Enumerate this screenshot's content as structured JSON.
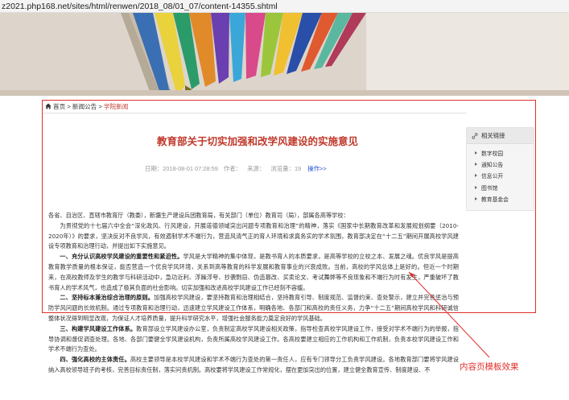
{
  "browser": {
    "url": "z2021.php168.net/sites/html/renwen/2018_08/01_07/content-14355.shtml"
  },
  "breadcrumb": {
    "home": "首页",
    "sep1": ">",
    "section": "新闻公告",
    "sep2": ">",
    "current": "学院新闻"
  },
  "article": {
    "title": "教育部关于切实加强和改学风建设的实施意见",
    "date": "日期：2018-08-01 07:28:59",
    "author": "作者：",
    "source": "来源：",
    "views": "浏览量：19",
    "action_link": "操作>>"
  },
  "body": {
    "p1": "各省、自治区、直辖市教育厅（教委），新疆生产建设兵团教育局，有关部门（单位）教育司（局），部属各高等学校：",
    "p2": "为贯彻党的十七届六中全会“深化政风、行风建设，开展道德领域突出问题专项教育和治理”的精神，落实《国家中长期教育改革和发展规划纲要（2010-2020年）》的要求，坚决反对不良学风，有效遏制学术不端行为，营造风清气正的育人环境和求真务实的学术氛围，教育部决定在“十二五”期间开展高校学风建设专项教育和治理行动，并提出如下实施意见。",
    "p3_head": "一、充分认识高校学风建设的重要性和紧迫性。",
    "p3": "学风是大学精神的集中体现，是教书育人的本质要求，是高等学校的立校之本、发展之魂。优良学风是提高教育教学质量的根本保证，能否营造一个优良学风环境，关系到高等教育的科学发展和教育事业的兴衰成败。当前，高校的学风总体上是好的。但近一个时期来，在高校教师及学生的教学与科研活动中，急功近利、浮躁浮夸、抄袭剽窃、伪造篡改、买卖论文、考试舞弊等不良现象和不端行为时有发生，严重破坏了教书育人的学术风气，也造成了极其负面的社会影响。切实加强和改进高校学风建设工作已经刻不容缓。",
    "p4_head": "二、坚持标本兼治综合治理的原则。",
    "p4": "加强高校学风建设，要坚持教育和治理相结合，坚持教育引导、制度规范、监督约束、查处警示，建立并完善惩治与预防学风问题的长效机制。通过专项教育和治理行动，迅速建立学风建设工作体系，明确各地、各部门和高校的责任义务，力争“十二五”期间高校学风和科研诚信整体状况得到明显改观，为保证人才培养质量，提升科学研究水平，增强社会服务能力奠定良好的学风基础。",
    "p5_head": "三、构建学风建设工作体系。",
    "p5": "教育部设立学风建设办公室，负责制定高校学风建设相关政策，指导检查高校学风建设工作，接受对学术不端行为的举报，指导协调和督促调查处理。各地、各部门要健全学风建设机构，负责所属高校学风建设工作。各高校要建立相应的工作机构和工作机制，负责本校学风建设工作和学术不端行为查处。",
    "p6_head": "四、强化高校的主体责任。",
    "p6": "高校主要领导是本校学风建设和学术不端行为查处的第一责任人，应有专门领导分工负责学风建设。各地教育部门要将学风建设纳入高校领导班子的考核，完善目标责任制，落实问责机制。高校要将学风建设工作常规化，摆在更加突出的位置，建立健全教育宣传、制度建设、不"
  },
  "sidebar": {
    "title": "相关链接",
    "items": [
      "数字校园",
      "通知公告",
      "信息公开",
      "图书馆",
      "教育基金会"
    ]
  },
  "annotation": {
    "label": "内容页模板效果",
    "color": "#e0302a"
  }
}
